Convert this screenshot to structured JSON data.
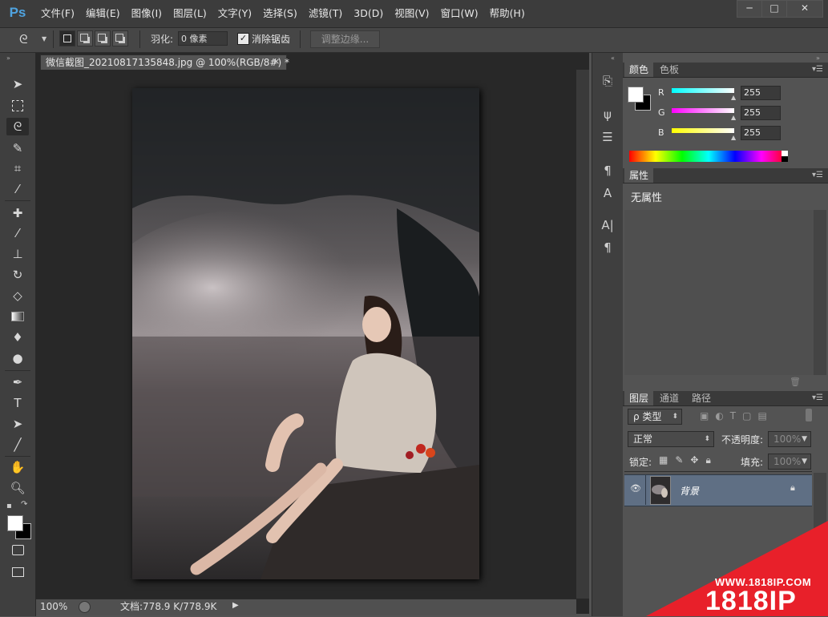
{
  "app": {
    "logo": "Ps"
  },
  "menu": [
    "文件(F)",
    "编辑(E)",
    "图像(I)",
    "图层(L)",
    "文字(Y)",
    "选择(S)",
    "滤镜(T)",
    "3D(D)",
    "视图(V)",
    "窗口(W)",
    "帮助(H)"
  ],
  "window": {
    "minimize": "─",
    "maximize": "□",
    "close": "✕"
  },
  "options": {
    "feather_label": "羽化:",
    "feather_value": "0 像素",
    "antialias_checked": true,
    "antialias_label": "消除锯齿",
    "refine_button": "调整边缘..."
  },
  "document": {
    "tab_title": "微信截图_20210817135848.jpg @ 100%(RGB/8#) *",
    "close": "×",
    "zoom": "100%",
    "info": "文档:778.9 K/778.9K"
  },
  "color_panel": {
    "tabs": [
      "颜色",
      "色板"
    ],
    "r_label": "R",
    "g_label": "G",
    "b_label": "B",
    "r": "255",
    "g": "255",
    "b": "255",
    "r_color": "#00ffff",
    "g_color": "#ff00ff",
    "b_color": "#ffff00"
  },
  "properties_panel": {
    "tab": "属性",
    "text": "无属性"
  },
  "layers_panel": {
    "tabs": [
      "图层",
      "通道",
      "路径"
    ],
    "filter_type": "ρ 类型",
    "blend_mode": "正常",
    "opacity_label": "不透明度:",
    "opacity_value": "100%",
    "lock_label": "锁定:",
    "fill_label": "填充:",
    "fill_value": "100%",
    "layer_name": "背景"
  },
  "watermark": {
    "url": "WWW.1818IP.COM",
    "brand": "1818IP",
    "color": "#e8202a"
  },
  "icons": {
    "tools": [
      "move-icon",
      "marquee-icon",
      "lasso-icon",
      "quick-select-icon",
      "crop-icon",
      "eyedropper-icon",
      "healing-brush-icon",
      "brush-icon",
      "clone-stamp-icon",
      "history-brush-icon",
      "eraser-icon",
      "gradient-icon",
      "blur-icon",
      "dodge-icon",
      "pen-icon",
      "type-icon",
      "path-select-icon",
      "line-icon",
      "hand-icon",
      "zoom-icon"
    ]
  }
}
